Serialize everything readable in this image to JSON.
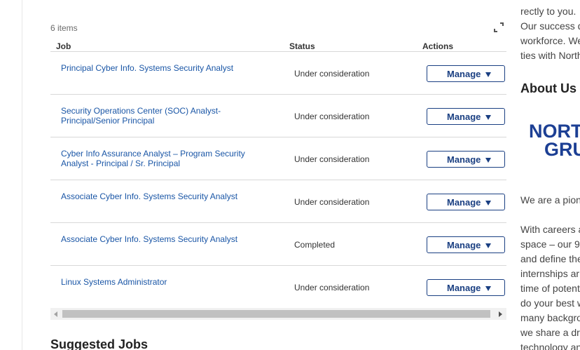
{
  "applications": {
    "count_label": "6 items",
    "columns": {
      "job": "Job",
      "status": "Status",
      "actions": "Actions"
    },
    "rows": [
      {
        "job_line1": "Principal Cyber Info. Systems Security Analyst",
        "job_line2": "",
        "status": "Under consideration",
        "action": "Manage"
      },
      {
        "job_line1": "Security Operations Center (SOC) Analyst-",
        "job_line2": "Principal/Senior Principal",
        "status": "Under consideration",
        "action": "Manage"
      },
      {
        "job_line1": "Cyber Info Assurance Analyst – Program Security",
        "job_line2": "Analyst - Principal / Sr. Principal",
        "status": "Under consideration",
        "action": "Manage"
      },
      {
        "job_line1": "Associate Cyber Info. Systems Security Analyst",
        "job_line2": "",
        "status": "Under consideration",
        "action": "Manage"
      },
      {
        "job_line1": "Associate Cyber Info. Systems Security Analyst",
        "job_line2": "",
        "status": "Completed",
        "action": "Manage"
      },
      {
        "job_line1": "Linux Systems Administrator",
        "job_line2": "",
        "status": "Under consideration",
        "action": "Manage"
      }
    ]
  },
  "suggested": {
    "heading": "Suggested Jobs"
  },
  "sidebar": {
    "top_lines": [
      "rectly to you.",
      "Our success d",
      "workforce. We",
      "ties with North"
    ],
    "about_heading": "About Us",
    "logo_text": [
      "NORT",
      "GRU"
    ],
    "intro": "We are a pion",
    "body_lines": [
      "With careers a",
      "space – our 9",
      "and define the",
      "internships ar",
      "time of potent",
      "do your best w",
      "many backgro",
      "we share a dri",
      "technology an"
    ]
  },
  "colors": {
    "link": "#1a56a6",
    "button_border": "#1a3f82",
    "logo": "#1c3f94"
  }
}
